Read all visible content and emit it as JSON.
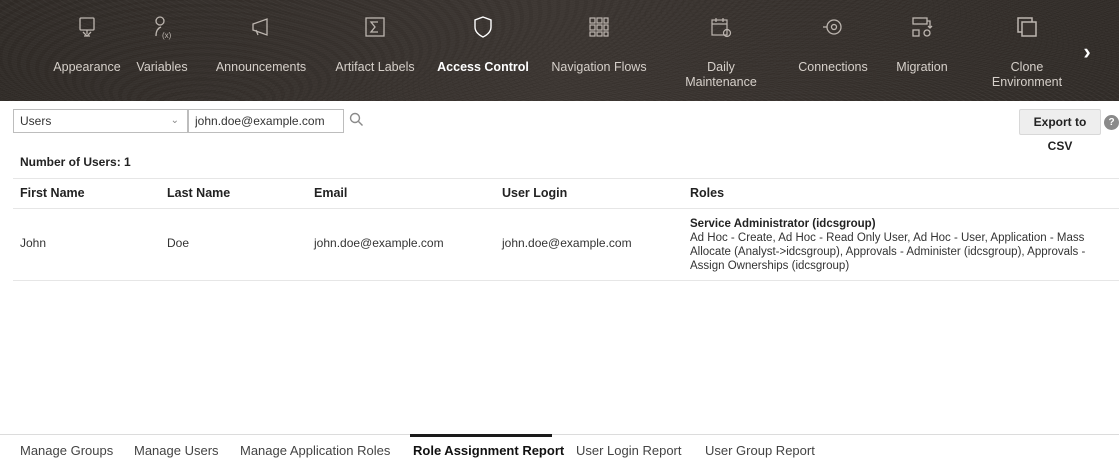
{
  "nav": {
    "items": [
      {
        "label": "Appearance",
        "icon": "appearance-icon"
      },
      {
        "label": "Variables",
        "icon": "variables-icon"
      },
      {
        "label": "Announcements",
        "icon": "announcements-icon"
      },
      {
        "label": "Artifact Labels",
        "icon": "artifact-labels-icon"
      },
      {
        "label": "Access Control",
        "icon": "access-control-icon",
        "active": true
      },
      {
        "label": "Navigation Flows",
        "icon": "navigation-flows-icon"
      },
      {
        "label": "Daily Maintenance",
        "icon": "daily-maintenance-icon"
      },
      {
        "label": "Connections",
        "icon": "connections-icon"
      },
      {
        "label": "Migration",
        "icon": "migration-icon"
      },
      {
        "label": "Clone Environment",
        "icon": "clone-environment-icon"
      }
    ],
    "next_label": "›"
  },
  "filter": {
    "type_value": "Users",
    "search_value": "john.doe@example.com",
    "export_label": "Export to CSV",
    "help_label": "?"
  },
  "report": {
    "count_label": "Number of Users: 1",
    "columns": [
      "First Name",
      "Last Name",
      "Email",
      "User Login",
      "Roles"
    ],
    "rows": [
      {
        "first_name": "John",
        "last_name": "Doe",
        "email": "john.doe@example.com",
        "user_login": "john.doe@example.com",
        "role_title": "Service Administrator (idcsgroup)",
        "role_details": "Ad Hoc - Create, Ad Hoc - Read Only User, Ad Hoc - User, Application - Mass Allocate (Analyst->idcsgroup), Approvals - Administer (idcsgroup), Approvals - Assign Ownerships (idcsgroup)"
      }
    ]
  },
  "tabs": [
    {
      "label": "Manage Groups"
    },
    {
      "label": "Manage Users"
    },
    {
      "label": "Manage Application Roles"
    },
    {
      "label": "Role Assignment Report",
      "active": true
    },
    {
      "label": "User Login Report"
    },
    {
      "label": "User Group Report"
    }
  ],
  "colors": {
    "nav_bg": "#2f2a26",
    "nav_text": "#d6d0ca",
    "active_tab": "#1a1a1a"
  }
}
